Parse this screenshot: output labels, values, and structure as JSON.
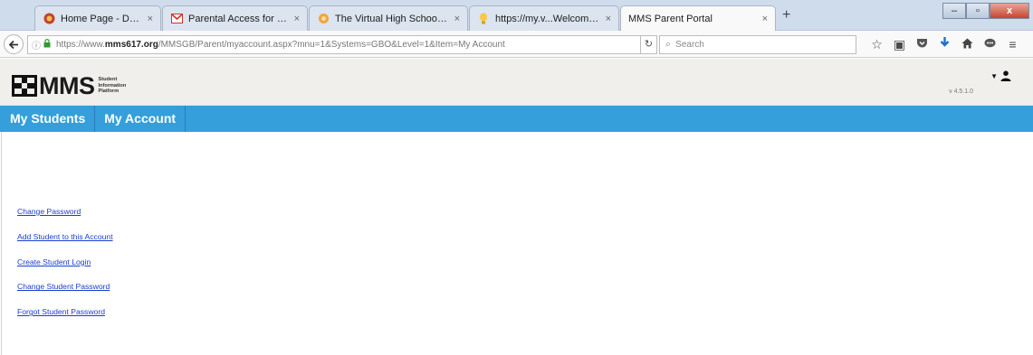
{
  "browser": {
    "tabs": [
      {
        "label": "Home Page - Delone Cath...",
        "icon": "globe-favicon"
      },
      {
        "label": "Parental Access for https://...",
        "icon": "gmail-favicon"
      },
      {
        "label": "The Virtual High School O...",
        "icon": "vhs-favicon"
      },
      {
        "label": "https://my.v...Welcome.aspx",
        "icon": "bulb-favicon"
      },
      {
        "label": "MMS Parent Portal",
        "icon": "none",
        "active": true
      }
    ],
    "tab_close_glyph": "×",
    "new_tab_glyph": "+",
    "window_buttons": {
      "minimize": "–",
      "maximize": "▫",
      "close": "x"
    },
    "url_prefix": "https://www.",
    "url_domain": "mms617.org",
    "url_path": "/MMSGB/Parent/myaccount.aspx?mnu=1&Systems=GBO&Level=1&Item=My Account",
    "search_placeholder": "Search",
    "toolbar_icons": [
      "star-icon",
      "clipboard-icon",
      "pocket-icon",
      "download-icon",
      "home-icon",
      "chat-icon",
      "menu-icon"
    ]
  },
  "header": {
    "logo_text": "MMS",
    "logo_sub_1": "Student",
    "logo_sub_2": "Information",
    "logo_sub_3": "Platform",
    "version": "v 4.5.1.0"
  },
  "nav": {
    "tabs": [
      {
        "label": "My Students"
      },
      {
        "label": "My Account"
      }
    ]
  },
  "account_links": [
    {
      "label": "Change Password"
    },
    {
      "label": "Add Student to this Account"
    },
    {
      "label": "Create Student Login"
    },
    {
      "label": "Change Student Password"
    },
    {
      "label": "Forgot Student Password"
    }
  ],
  "colors": {
    "nav_bar": "#349fdb",
    "header_bg": "#f0efeb",
    "link": "#1a3ecf"
  }
}
